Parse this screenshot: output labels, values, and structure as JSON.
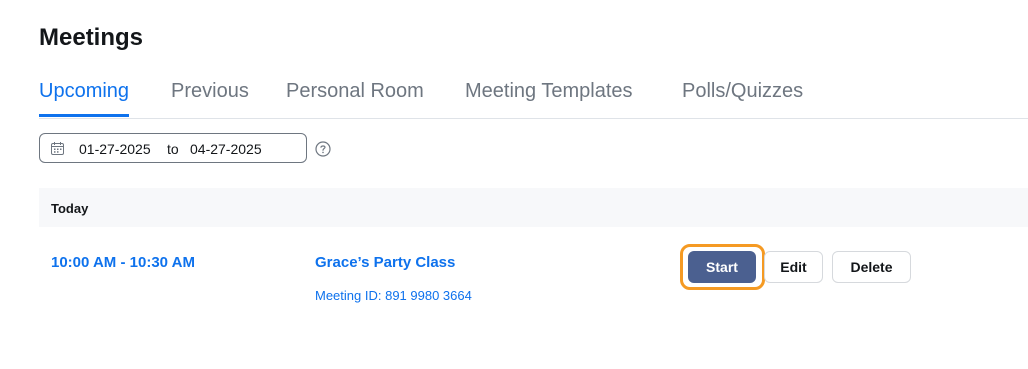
{
  "page": {
    "title": "Meetings"
  },
  "tabs": [
    {
      "label": "Upcoming",
      "active": true
    },
    {
      "label": "Previous",
      "active": false
    },
    {
      "label": "Personal Room",
      "active": false
    },
    {
      "label": "Meeting Templates",
      "active": false
    },
    {
      "label": "Polls/Quizzes",
      "active": false
    }
  ],
  "date_range": {
    "start": "01-27-2025",
    "separator": "to",
    "end": "04-27-2025",
    "icon": "calendar-icon"
  },
  "help": {
    "icon": "question-circle-icon"
  },
  "section": {
    "label": "Today"
  },
  "meeting": {
    "time": "10:00 AM - 10:30 AM",
    "title": "Grace’s Party Class",
    "meeting_id": "Meeting ID: 891 9980 3664"
  },
  "actions": {
    "start": "Start",
    "edit": "Edit",
    "delete": "Delete"
  },
  "colors": {
    "accent": "#0e72ed",
    "start_button": "#4b6090",
    "focus_ring": "#f59a23",
    "section_bg": "#f7f8fa"
  }
}
